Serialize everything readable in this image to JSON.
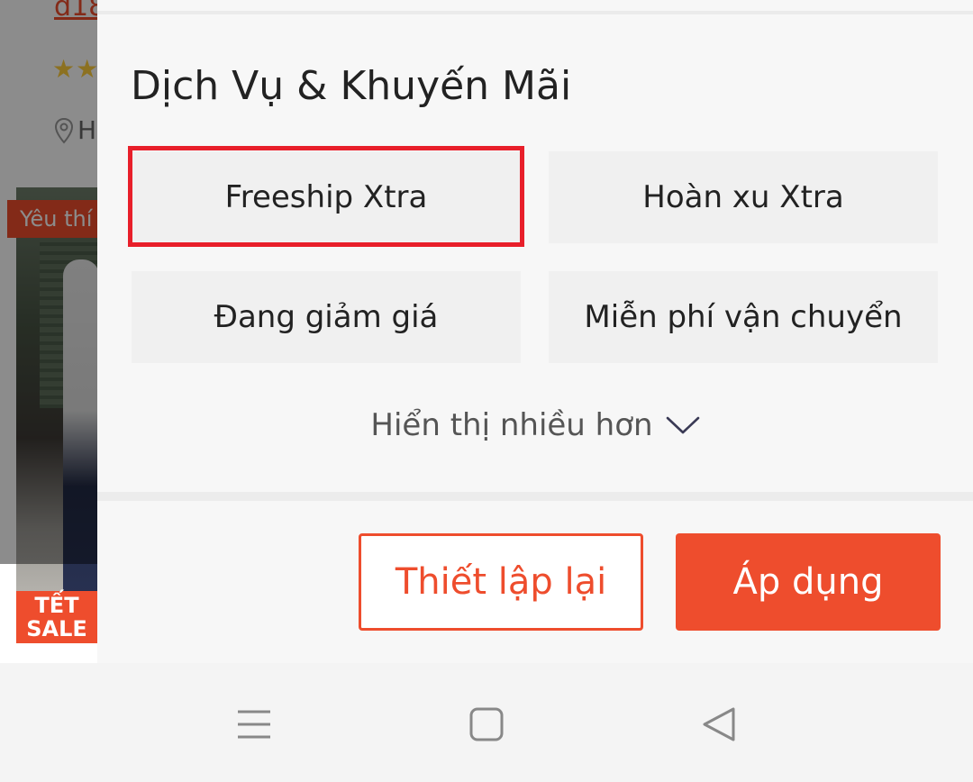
{
  "background": {
    "price_fragment": "đ18",
    "stars": "★★★",
    "location_fragment": "Hà",
    "tag_fragment": "Yêu thí",
    "sale_badge": [
      "TẾT",
      "SALE"
    ]
  },
  "filter_panel": {
    "section_title": "Dịch Vụ & Khuyến Mãi",
    "options": [
      {
        "label": "Freeship Xtra",
        "highlighted": true
      },
      {
        "label": "Hoàn xu Xtra",
        "highlighted": false
      },
      {
        "label": "Đang giảm giá",
        "highlighted": false
      },
      {
        "label": "Miễn phí vận chuyển",
        "highlighted": false
      }
    ],
    "show_more_label": "Hiển thị nhiều hơn",
    "reset_label": "Thiết lập lại",
    "apply_label": "Áp dụng"
  },
  "colors": {
    "accent": "#ee4d2d",
    "highlight_border": "#e81f2a",
    "chip_background": "#f0f0f0"
  },
  "navbar": {
    "icons": [
      "menu-icon",
      "home-icon",
      "back-icon"
    ]
  }
}
